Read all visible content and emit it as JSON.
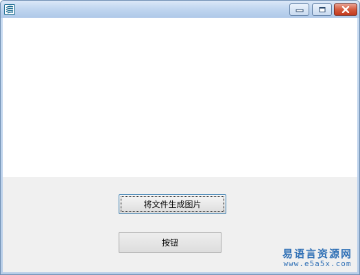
{
  "window": {
    "title": "",
    "icon": "app-logo-icon",
    "controls": {
      "minimize_icon": "minimize-icon",
      "maximize_icon": "maximize-icon",
      "close_icon": "close-icon"
    }
  },
  "buttons": {
    "generate_label": "将文件生成图片",
    "plain_label": "按钮"
  },
  "watermark": {
    "title": "易语言资源网",
    "url": "www.e5a5x.com"
  },
  "colors": {
    "titlebar": "#c2d7f0",
    "close_button": "#c94a2e",
    "client_background": "#f0f0f0",
    "watermark": "#2e6fb5"
  }
}
